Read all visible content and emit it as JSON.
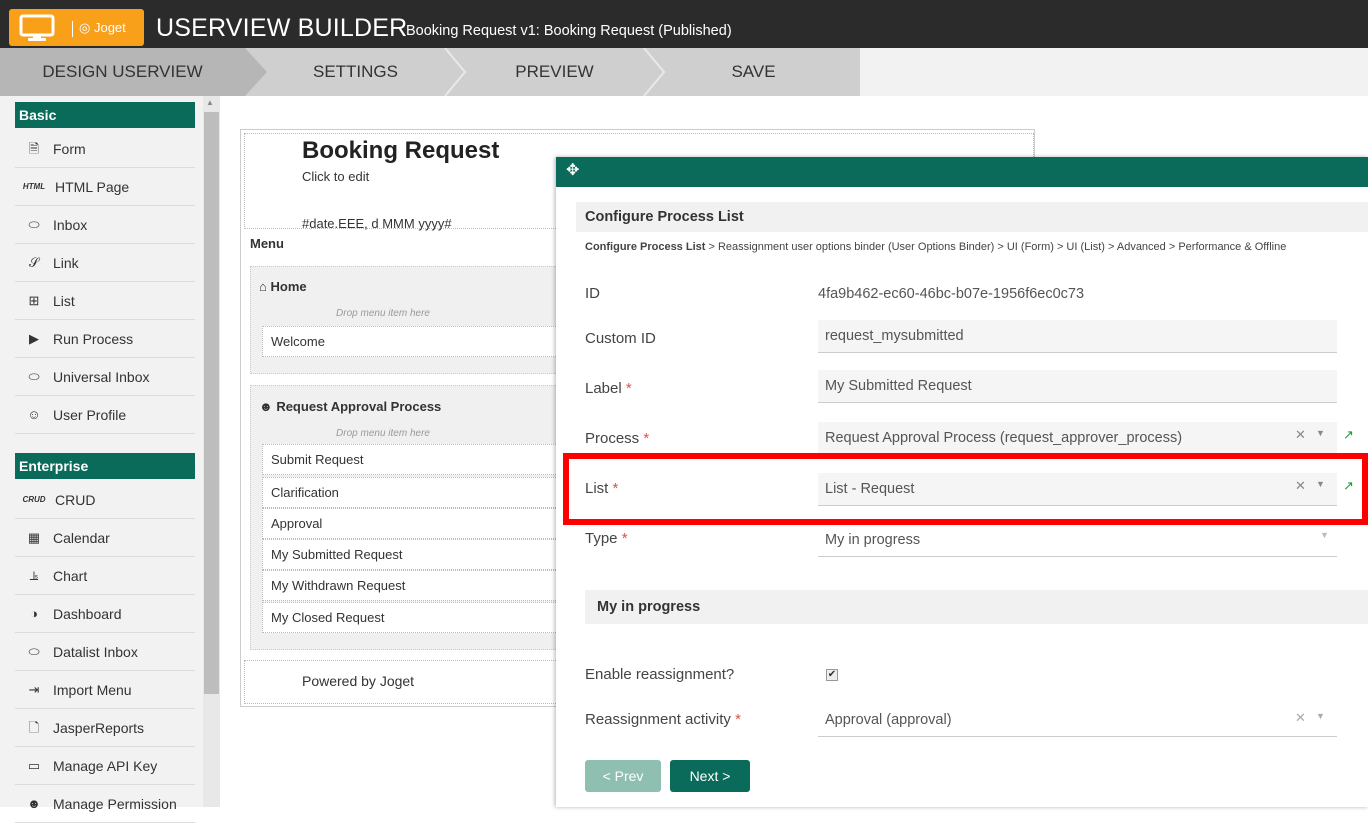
{
  "header": {
    "brand": "Joget",
    "title": "USERVIEW BUILDER",
    "subtitle": "Booking Request v1: Booking Request (Published)"
  },
  "tabs": [
    {
      "label": "DESIGN USERVIEW",
      "active": true
    },
    {
      "label": "SETTINGS"
    },
    {
      "label": "PREVIEW"
    },
    {
      "label": "SAVE"
    }
  ],
  "sidebar": {
    "basic": {
      "heading": "Basic",
      "items": [
        {
          "label": "Form",
          "icon": "form-icon"
        },
        {
          "label": "HTML Page",
          "icon": "html-icon",
          "glyph": "HTML"
        },
        {
          "label": "Inbox",
          "icon": "inbox-icon"
        },
        {
          "label": "Link",
          "icon": "link-icon"
        },
        {
          "label": "List",
          "icon": "list-icon"
        },
        {
          "label": "Run Process",
          "icon": "play-icon"
        },
        {
          "label": "Universal Inbox",
          "icon": "inbox-icon"
        },
        {
          "label": "User Profile",
          "icon": "user-edit-icon"
        }
      ]
    },
    "enterprise": {
      "heading": "Enterprise",
      "items": [
        {
          "label": "CRUD",
          "icon": "crud-icon",
          "glyph": "CRUD"
        },
        {
          "label": "Calendar",
          "icon": "calendar-icon"
        },
        {
          "label": "Chart",
          "icon": "chart-icon"
        },
        {
          "label": "Dashboard",
          "icon": "dashboard-icon"
        },
        {
          "label": "Datalist Inbox",
          "icon": "inbox-icon"
        },
        {
          "label": "Import Menu",
          "icon": "import-icon"
        },
        {
          "label": "JasperReports",
          "icon": "report-icon"
        },
        {
          "label": "Manage API Key",
          "icon": "monitor-icon"
        },
        {
          "label": "Manage Permission",
          "icon": "users-icon"
        }
      ]
    }
  },
  "canvas": {
    "title": "Booking Request",
    "click_to_edit": "Click to edit",
    "date_pattern": "#date.EEE, d MMM yyyy#",
    "menu_label": "Menu",
    "drop_hint": "Drop menu item here",
    "categories": [
      {
        "name": "Home",
        "items": [
          "Welcome"
        ]
      },
      {
        "name": "Request Approval Process",
        "items": [
          "Submit Request",
          "Clarification",
          "Approval",
          "My Submitted Request",
          "My Withdrawn Request",
          "My Closed Request"
        ]
      }
    ],
    "footer": "Powered by Joget"
  },
  "dialog": {
    "section_title": "Configure Process List",
    "breadcrumb_first": "Configure Process List",
    "breadcrumb_rest": " > Reassignment user options binder (User Options Binder) > UI (Form) > UI (List) > Advanced > Performance & Offline",
    "fields": {
      "id": {
        "label": "ID",
        "value": "4fa9b462-ec60-46bc-b07e-1956f6ec0c73"
      },
      "custom_id": {
        "label": "Custom ID",
        "value": "request_mysubmitted"
      },
      "label": {
        "label": "Label",
        "value": "My Submitted Request"
      },
      "process": {
        "label": "Process",
        "value": "Request Approval Process (request_approver_process)"
      },
      "list": {
        "label": "List",
        "value": "List - Request"
      },
      "type": {
        "label": "Type",
        "value": "My in progress"
      }
    },
    "subsection_title": "My in progress",
    "enable_reassignment": {
      "label": "Enable reassignment?",
      "checked": true
    },
    "reassignment_activity": {
      "label": "Reassignment activity",
      "value": "Approval (approval)"
    },
    "prev_label": "< Prev",
    "next_label": "Next >"
  },
  "colors": {
    "accent": "#0b6b5a",
    "brand_orange": "#f9a01b",
    "highlight": "#ff0000"
  }
}
